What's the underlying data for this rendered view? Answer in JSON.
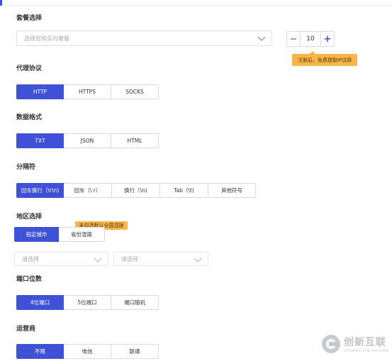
{
  "package": {
    "title": "套餐选择",
    "select_placeholder": "选择您购买的套餐",
    "stepper_minus": "−",
    "stepper_value": "10",
    "stepper_plus": "+",
    "tip": "注册后，免费提取IP试用"
  },
  "protocol": {
    "title": "代理协议",
    "options": [
      "HTTP",
      "HTTPS",
      "SOCKS"
    ],
    "selected": "HTTP"
  },
  "format": {
    "title": "数据格式",
    "options": [
      "TXT",
      "JSON",
      "HTML"
    ],
    "selected": "TXT"
  },
  "separator": {
    "title": "分隔符",
    "options": [
      "回车换行（\\r\\n)",
      "回车（\\ r）",
      "换行（\\n)",
      "Tab（\\t)",
      "其他符号"
    ],
    "selected": "回车换行（\\r\\n)"
  },
  "region": {
    "title": "地区选择",
    "options": [
      "指定城市",
      "省份混拨"
    ],
    "selected": "指定城市",
    "tip": "未勾选默认全国混拨",
    "province_placeholder": "请选择",
    "city_placeholder": "请选择"
  },
  "port_digits": {
    "title": "端口位数",
    "options": [
      "4位端口",
      "5位端口",
      "端口随机"
    ],
    "selected": "4位端口"
  },
  "carrier": {
    "title": "运营商",
    "options": [
      "不限",
      "电信",
      "联通"
    ],
    "selected": "不限"
  },
  "watermark": {
    "brand": "创新互联",
    "sub": "CHUANG XIN HU LIAN"
  },
  "colors": {
    "accent": "#3f51d6",
    "tip_bg": "#f6b64a",
    "border": "#d7dae2"
  }
}
